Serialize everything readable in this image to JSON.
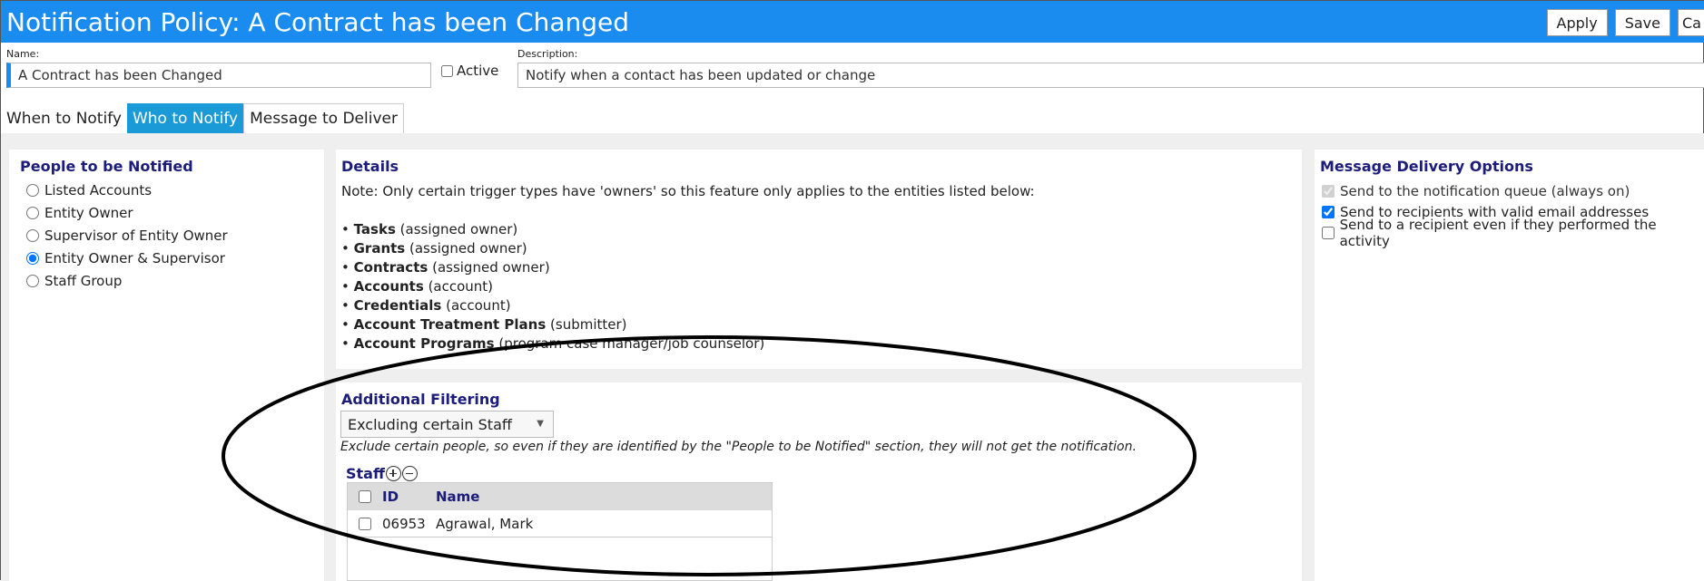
{
  "header": {
    "title": "Notification Policy: A Contract has been Changed",
    "buttons": {
      "apply": "Apply",
      "save": "Save",
      "cancel_partial": "Ca"
    }
  },
  "form": {
    "name_label": "Name:",
    "name_value": "A Contract has been Changed",
    "active_label": "Active",
    "description_label": "Description:",
    "description_value": "Notify when a contact has been updated or change"
  },
  "tabs": [
    {
      "label": "When to Notify"
    },
    {
      "label": "Who to Notify"
    },
    {
      "label": "Message to Deliver"
    }
  ],
  "people": {
    "title": "People to be Notified",
    "options": [
      "Listed Accounts",
      "Entity Owner",
      "Supervisor of Entity Owner",
      "Entity Owner & Supervisor",
      "Staff Group"
    ],
    "selected": "Entity Owner & Supervisor"
  },
  "details": {
    "title": "Details",
    "note": "Note: Only certain trigger types have 'owners' so this feature only applies to the entities listed below:",
    "entities": [
      {
        "name": "Tasks",
        "role": "(assigned owner)"
      },
      {
        "name": "Grants",
        "role": "(assigned owner)"
      },
      {
        "name": "Contracts",
        "role": "(assigned owner)"
      },
      {
        "name": "Accounts",
        "role": "(account)"
      },
      {
        "name": "Credentials",
        "role": "(account)"
      },
      {
        "name": "Account Treatment Plans",
        "role": "(submitter)"
      },
      {
        "name": "Account Programs",
        "role": "(program case manager/job counselor)"
      }
    ]
  },
  "filtering": {
    "title": "Additional Filtering",
    "selected_option": "Excluding certain Staff",
    "note": "Exclude certain people, so even if they are identified by the \"People to be Notified\" section, they will not get the notification.",
    "staff_label": "Staff",
    "grid": {
      "columns": [
        "ID",
        "Name"
      ],
      "rows": [
        {
          "id": "06953",
          "name": "Agrawal, Mark"
        }
      ]
    }
  },
  "delivery": {
    "title": "Message Delivery Options",
    "options": [
      {
        "label": "Send to the notification queue (always on)",
        "checked": true,
        "disabled": true
      },
      {
        "label": "Send to recipients with valid email addresses",
        "checked": true,
        "disabled": false
      },
      {
        "label": "Send to a recipient even if they performed the activity",
        "checked": false,
        "disabled": false
      }
    ]
  },
  "colors": {
    "header_blue": "#1a8cf0",
    "tab_active": "#1a9ad6",
    "heading_navy": "#1c1c7a"
  },
  "icons": {
    "add": "plus-circle-icon",
    "remove": "minus-circle-icon",
    "dropdown": "chevron-down-icon"
  }
}
